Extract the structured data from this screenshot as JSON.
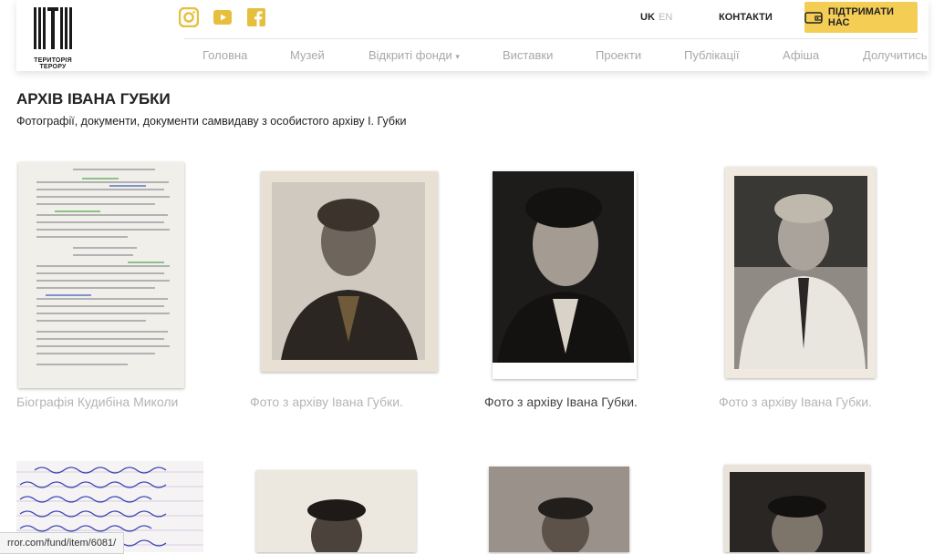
{
  "header": {
    "logo_text": "ТЕРИТОРІЯ ТЕРОРУ",
    "social": [
      {
        "icon": "instagram-icon"
      },
      {
        "icon": "youtube-icon"
      },
      {
        "icon": "facebook-icon"
      }
    ],
    "lang": {
      "uk": "UK",
      "en": "EN"
    },
    "contacts": "КОНТАКТИ",
    "support": "ПІДТРИМАТИ НАС",
    "accent": "#f4cd55"
  },
  "nav": [
    "Головна",
    "Музей",
    "Відкриті фонди",
    "Виставки",
    "Проекти",
    "Публікації",
    "Афіша",
    "Долучитись"
  ],
  "nav_dropdown_mark": "▾",
  "page": {
    "title": "АРХІВ ІВАНА ГУБКИ",
    "subtitle": "Фотографії, документи, документи самвидаву з особистого архіву І. Губки"
  },
  "items": [
    {
      "caption": "Біографія Кудибіна Миколи",
      "kind": "document"
    },
    {
      "caption": "Фото з архіву Івана Губки.",
      "kind": "portrait"
    },
    {
      "caption": "Фото з архіву Івана Губки.",
      "kind": "portrait"
    },
    {
      "caption": "Фото з архіву Івана Губки.",
      "kind": "portrait"
    },
    {
      "caption": "",
      "kind": "handwritten"
    },
    {
      "caption": "",
      "kind": "portrait"
    },
    {
      "caption": "",
      "kind": "portrait"
    },
    {
      "caption": "",
      "kind": "portrait"
    }
  ],
  "statusbar": "rror.com/fund/item/6081/"
}
